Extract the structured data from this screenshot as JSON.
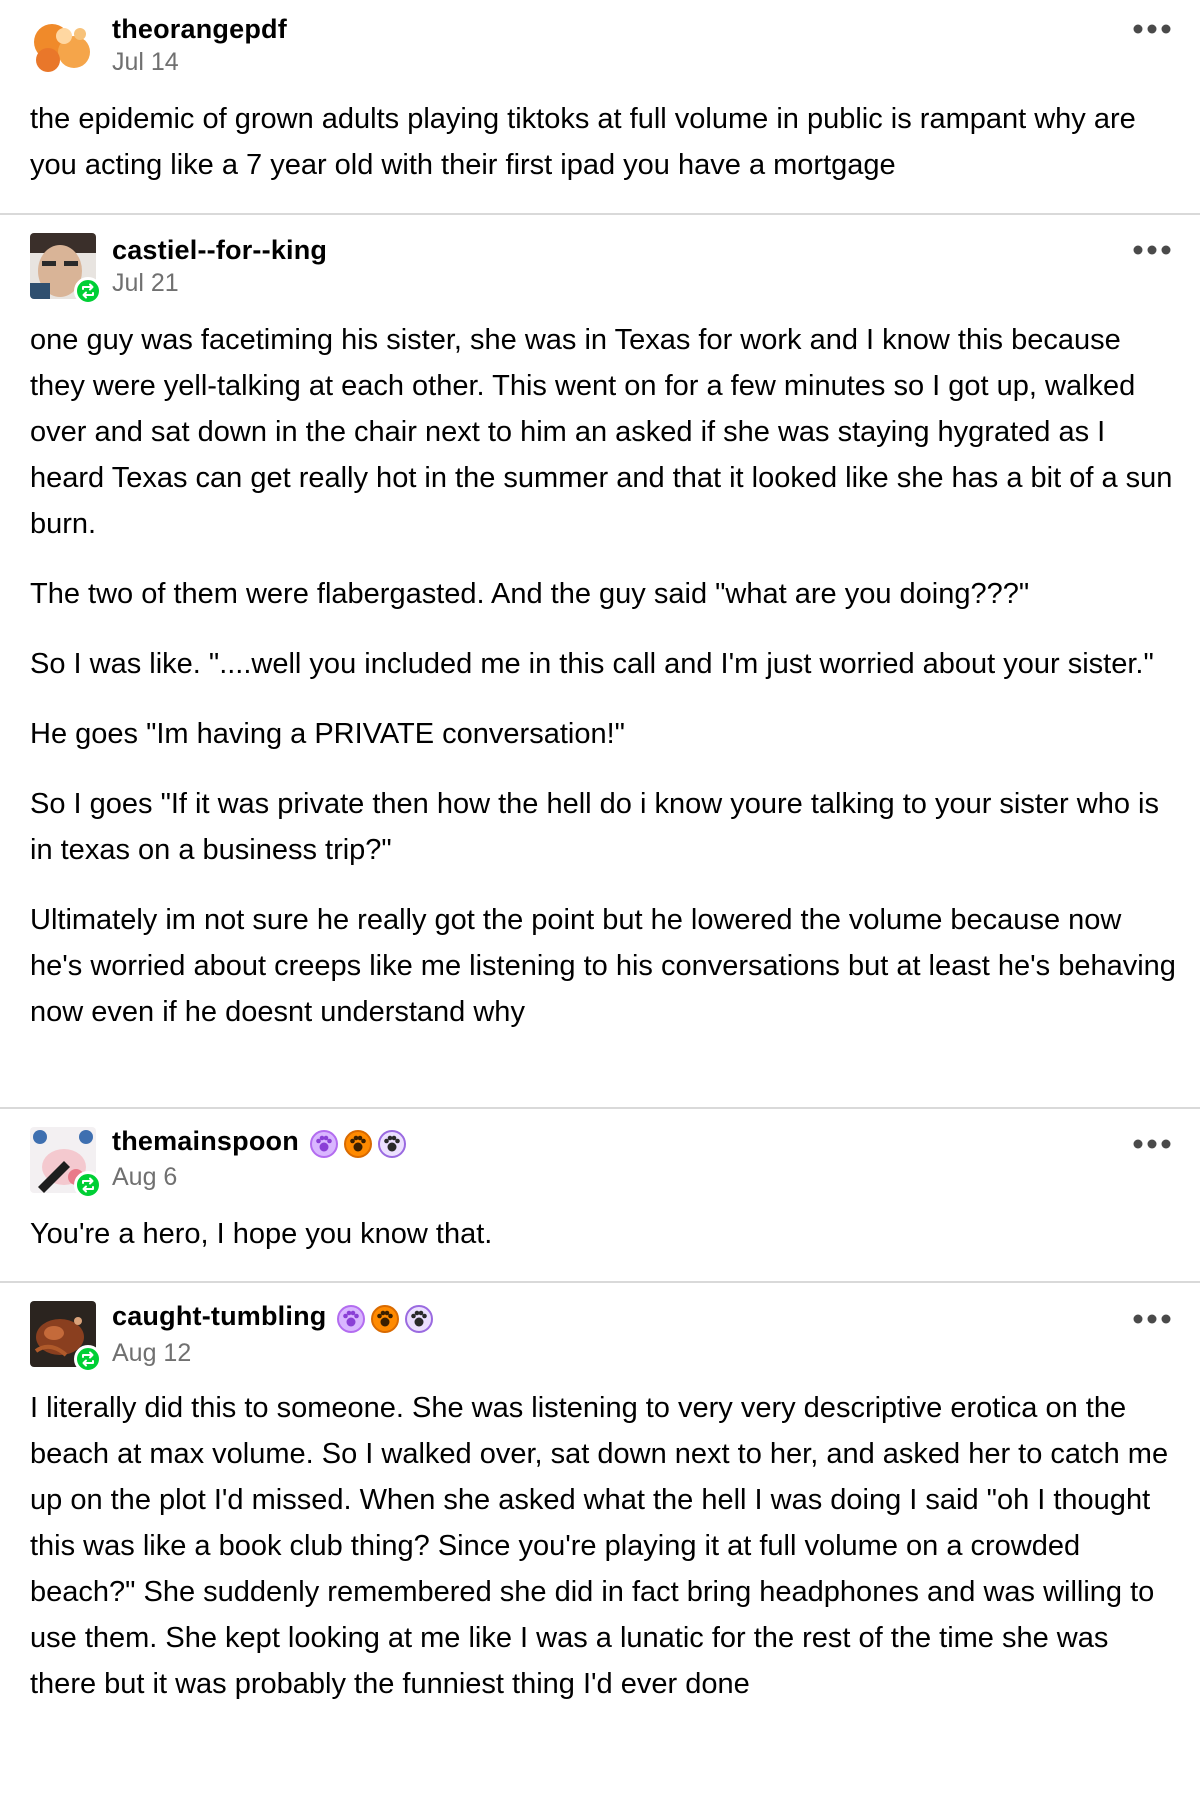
{
  "posts": [
    {
      "username": "theorangepdf",
      "date": "Jul 14",
      "paragraphs": [
        "the epidemic of grown adults playing tiktoks at full volume in public is rampant why are you  acting like a 7 year old with their first ipad you have a mortgage"
      ]
    },
    {
      "username": "castiel--for--king",
      "date": "Jul 21",
      "paragraphs": [
        "one guy was facetiming his sister, she was in Texas for work and I know this because they were yell-talking at each other. This went on for a few minutes so I got up, walked over and sat down in the chair next to him an asked if she was staying hygrated as I heard Texas can get really hot in the summer and that it looked like she has a bit of a sun burn.",
        "The two of them were flabergasted. And the guy said \"what are you doing???\"",
        "So I was like. \"....well you included me in this call and I'm just worried about your sister.\"",
        "He goes \"Im having a PRIVATE conversation!\"",
        "So I goes \"If it was private then how the hell do i know youre talking to your sister who is in texas on a business trip?\"",
        "Ultimately im not sure he really got the point but he lowered the volume because now he's worried about creeps like me listening to his conversations but at least he's behaving now even if he doesnt understand why"
      ]
    },
    {
      "username": "themainspoon",
      "date": "Aug 6",
      "paragraphs": [
        "You're a hero, I hope you know that."
      ]
    },
    {
      "username": "caught-tumbling",
      "date": "Aug 12",
      "paragraphs": [
        "I literally did this to someone. She was listening to very very descriptive erotica on the beach at max volume. So I walked over, sat down next to her, and asked her to catch me up on the plot I'd missed. When she asked what the hell I was doing I said \"oh I thought this was like a book club thing? Since you're playing it at full volume on a crowded beach?\" She suddenly remembered she did in fact bring headphones and was willing to use them. She kept looking at me like I was a lunatic for the rest of the time she was there but it was probably the funniest thing I'd ever done"
      ]
    }
  ],
  "colors": {
    "reblog_green": "#00cf35",
    "date_gray": "#707070",
    "divider": "#d9d9d9",
    "badge_purple": "#b36cf0",
    "badge_orange": "#ff8a00"
  },
  "icons": {
    "more": "ellipsis-icon",
    "reblog": "reblog-icon",
    "badges": [
      "paw-badge-icon",
      "paw-badge-icon",
      "paw-badge-icon"
    ]
  }
}
